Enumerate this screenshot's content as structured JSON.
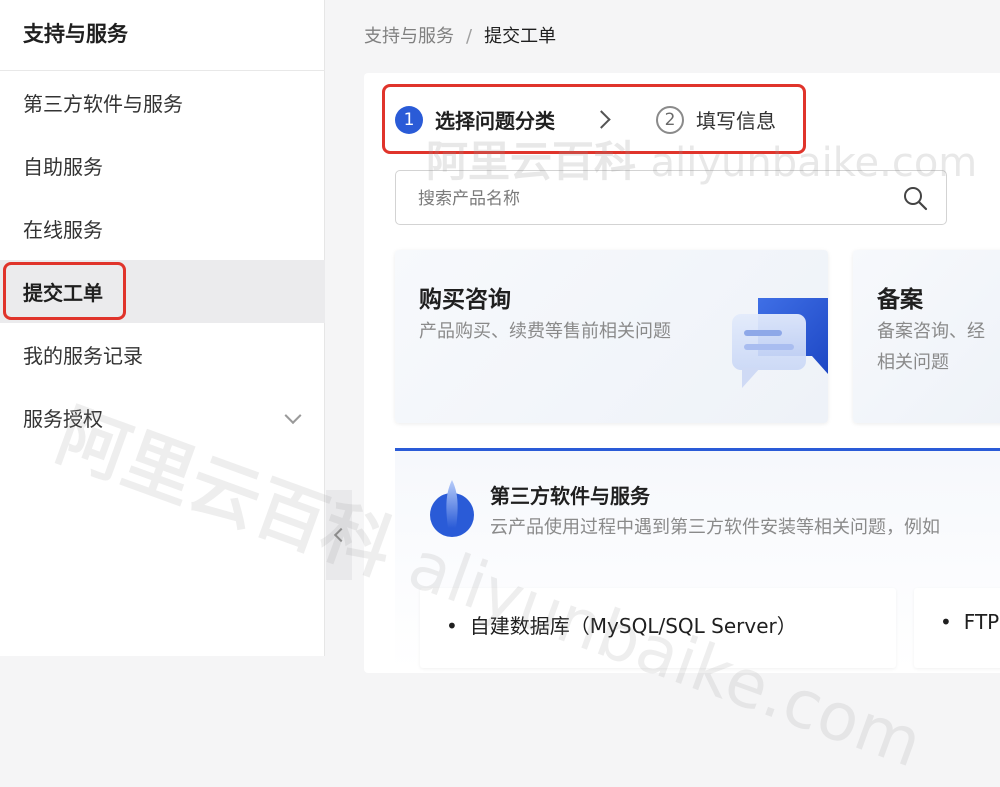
{
  "sidebar": {
    "title": "支持与服务",
    "items": [
      {
        "label": "第三方软件与服务"
      },
      {
        "label": "自助服务"
      },
      {
        "label": "在线服务"
      },
      {
        "label": "提交工单"
      },
      {
        "label": "我的服务记录"
      },
      {
        "label": "服务授权"
      }
    ]
  },
  "breadcrumb": {
    "parent": "支持与服务",
    "separator": "/",
    "current": "提交工单"
  },
  "steps": [
    {
      "number": "1",
      "label": "选择问题分类"
    },
    {
      "number": "2",
      "label": "填写信息"
    }
  ],
  "search": {
    "placeholder": "搜索产品名称"
  },
  "cards": [
    {
      "title": "购买咨询",
      "desc": "产品购买、续费等售前相关问题"
    },
    {
      "title": "备案",
      "desc_line1": "备案咨询、经",
      "desc_line2": "相关问题"
    }
  ],
  "third_party": {
    "title": "第三方软件与服务",
    "desc": "云产品使用过程中遇到第三方软件安装等相关问题，例如",
    "items": [
      "自建数据库（MySQL/SQL Server）",
      "FTP"
    ]
  },
  "watermark": {
    "cn": "阿里云百科",
    "en": "aliyunbaike.com"
  },
  "colors": {
    "accent": "#2a5bd7",
    "highlight_red": "#e0342b"
  }
}
